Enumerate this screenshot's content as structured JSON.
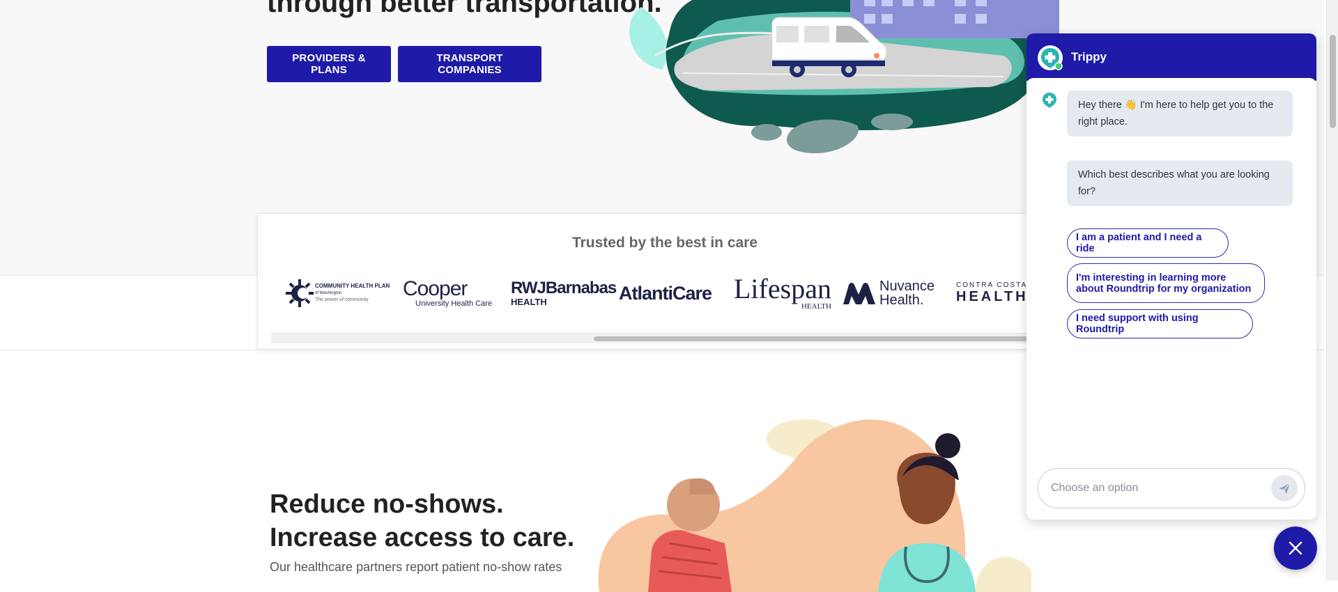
{
  "hero": {
    "heading": "through better transportation.",
    "buttons": [
      "PROVIDERS & PLANS",
      "TRANSPORT COMPANIES"
    ]
  },
  "trusted": {
    "title": "Trusted by the best in care",
    "logos": [
      {
        "name": "community-health-plan",
        "line1": "COMMUNITY HEALTH PLAN",
        "line2": "of Washington",
        "line3": "The power of community"
      },
      {
        "name": "cooper",
        "line1": "Cooper",
        "line2": "University Health Care"
      },
      {
        "name": "rwjbarnabas",
        "line1": "RWJBarnabas",
        "line2": "HEALTH"
      },
      {
        "name": "atlanticare",
        "line1": "AtlantiCare"
      },
      {
        "name": "lifespan",
        "line1": "Lifespan",
        "line2": "HEALTH"
      },
      {
        "name": "nuvance",
        "line1": "Nuvance",
        "line2": "Health."
      },
      {
        "name": "contra-costa",
        "line1": "CONTRA COSTA",
        "line2": "HEALTH"
      }
    ]
  },
  "section2": {
    "heading_line1": "Reduce no-shows.",
    "heading_line2": "Increase access to care.",
    "paragraph": "Our healthcare partners report patient no-show rates"
  },
  "chat": {
    "bot_name": "Trippy",
    "messages": [
      "Hey there 👋 I'm here to help get you to the right place.",
      "Which best describes what you are looking for?"
    ],
    "options": [
      "I am a patient and I need a ride",
      "I'm interesting in learning more about Roundtrip for my organization",
      "I need support with using Roundtrip"
    ],
    "input_placeholder": "Choose an option"
  },
  "colors": {
    "primary": "#1f1aa8",
    "teal": "#2bb5b0",
    "bubble": "#e4eaf0"
  },
  "icons": {
    "send": "send-icon",
    "close": "close-icon",
    "bot": "medical-cross-icon"
  }
}
